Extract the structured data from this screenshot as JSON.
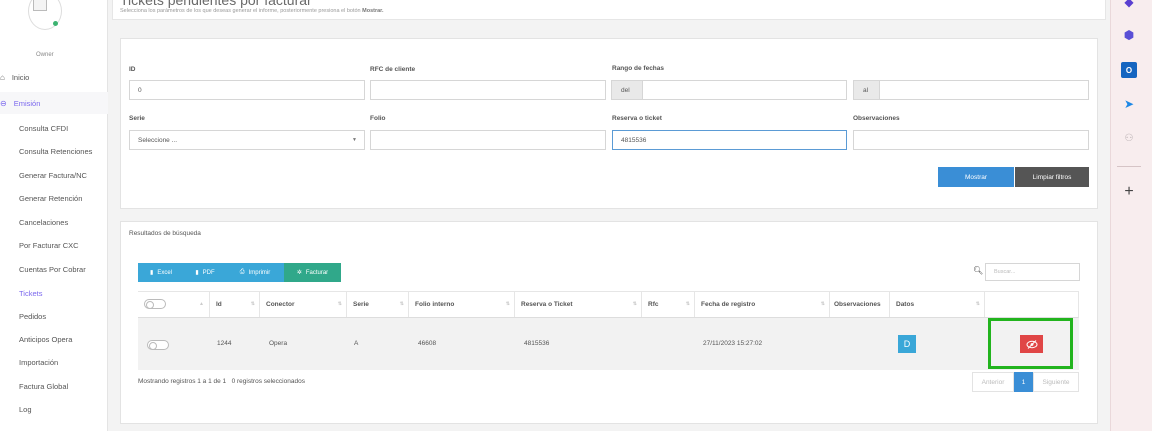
{
  "sidebar": {
    "owner": "Owner",
    "inicio": "Inicio",
    "emision": "Emisión",
    "items": [
      {
        "label": "Consulta CFDI"
      },
      {
        "label": "Consulta Retenciones"
      },
      {
        "label": "Generar Factura/NC"
      },
      {
        "label": "Generar Retención"
      },
      {
        "label": "Cancelaciones"
      },
      {
        "label": "Por Facturar CXC"
      },
      {
        "label": "Cuentas Por Cobrar"
      },
      {
        "label": "Tickets"
      },
      {
        "label": "Pedidos"
      },
      {
        "label": "Anticipos Opera"
      },
      {
        "label": "Importación"
      },
      {
        "label": "Factura Global"
      },
      {
        "label": "Log"
      }
    ]
  },
  "header": {
    "title": "Tickets pendientes por facturar",
    "subtitle_prefix": "Selecciona los parámetros de los que deseas generar el informe, posteriormente presiona el botón",
    "subtitle_button": "Mostrar."
  },
  "filters": {
    "id_label": "ID",
    "id_value": "0",
    "rfc_label": "RFC de cliente",
    "rfc_value": "",
    "range_label": "Rango de fechas",
    "range_from": "del",
    "range_to": "al",
    "serie_label": "Serie",
    "serie_value": "Seleccione ...",
    "folio_label": "Folio",
    "folio_value": "",
    "reserva_label": "Reserva o ticket",
    "reserva_value": "4815536",
    "obs_label": "Observaciones",
    "obs_value": "",
    "mostrar": "Mostrar",
    "limpiar": "Limpiar filtros"
  },
  "results": {
    "title": "Resultados de búsqueda",
    "toolbar": {
      "excel": "Excel",
      "pdf": "PDF",
      "imprimir": "Imprimir",
      "facturar": "Facturar"
    },
    "search_placeholder": "Buscar...",
    "columns": [
      "Id",
      "Conector",
      "Serie",
      "Folio interno",
      "Reserva o Ticket",
      "Rfc",
      "Fecha de registro",
      "Observaciones",
      "Datos"
    ],
    "rows": [
      {
        "id": "1244",
        "conector": "Opera",
        "serie": "A",
        "folio": "46608",
        "reserva": "4815536",
        "rfc": "",
        "fecha": "27/11/2023 15:27:02",
        "obs": "",
        "datos": "D"
      }
    ],
    "footer": "Mostrando registros 1 a 1 de 1",
    "selected": "0 registros seleccionados",
    "pager": {
      "prev": "Anterior",
      "page": "1",
      "next": "Siguiente"
    }
  },
  "colors": {
    "accent": "#3a8ed6",
    "dark_button": "#555555",
    "toolbar": "#3aa7d8",
    "facturar": "#30a88a",
    "delete": "#e04646",
    "highlight": "#22b41e"
  }
}
